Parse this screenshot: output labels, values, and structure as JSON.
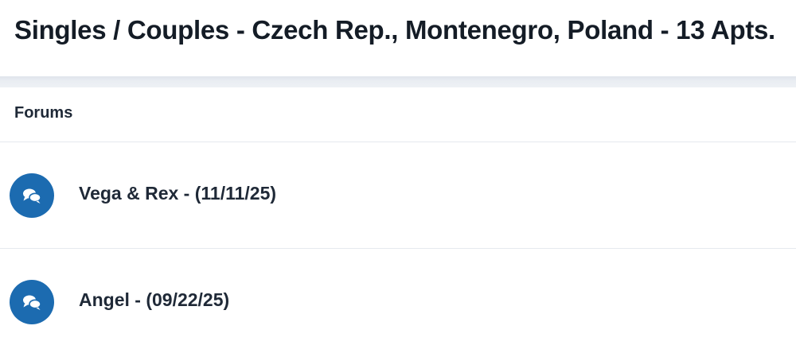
{
  "page": {
    "title": "Singles / Couples - Czech Rep., Montenegro, Poland - 13 Apts."
  },
  "forums": {
    "header": "Forums",
    "items": [
      {
        "title": "Vega & Rex - (11/11/25)",
        "icon": "comments-icon"
      },
      {
        "title": "Angel - (09/22/25)",
        "icon": "comments-icon"
      }
    ]
  },
  "colors": {
    "accent": "#1c6bb0",
    "text": "#1f2937",
    "separator": "#e9edf2"
  }
}
